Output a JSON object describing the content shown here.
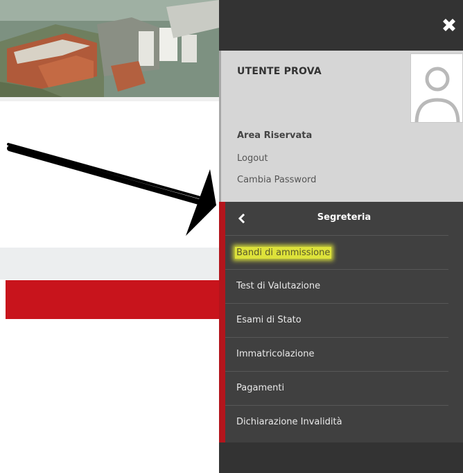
{
  "user_panel": {
    "name": "UTENTE PROVA",
    "area_title": "Area Riservata",
    "logout": "Logout",
    "change_password": "Cambia Password"
  },
  "menu": {
    "header": "Segreteria",
    "items": [
      {
        "label": "Bandi di ammissione",
        "highlighted": true
      },
      {
        "label": "Test di Valutazione"
      },
      {
        "label": "Esami di Stato"
      },
      {
        "label": "Immatricolazione"
      },
      {
        "label": "Pagamenti"
      },
      {
        "label": "Dichiarazione Invalidità"
      }
    ]
  },
  "icons": {
    "close": "close-icon",
    "back": "chevron-left-icon",
    "avatar": "user-avatar-icon",
    "annotation": "arrow-icon"
  },
  "colors": {
    "menu_bg": "#404040",
    "topbar_bg": "#333333",
    "accent_red": "#b3151c",
    "highlight": "#dde23a",
    "user_panel_bg": "#d6d6d6"
  }
}
